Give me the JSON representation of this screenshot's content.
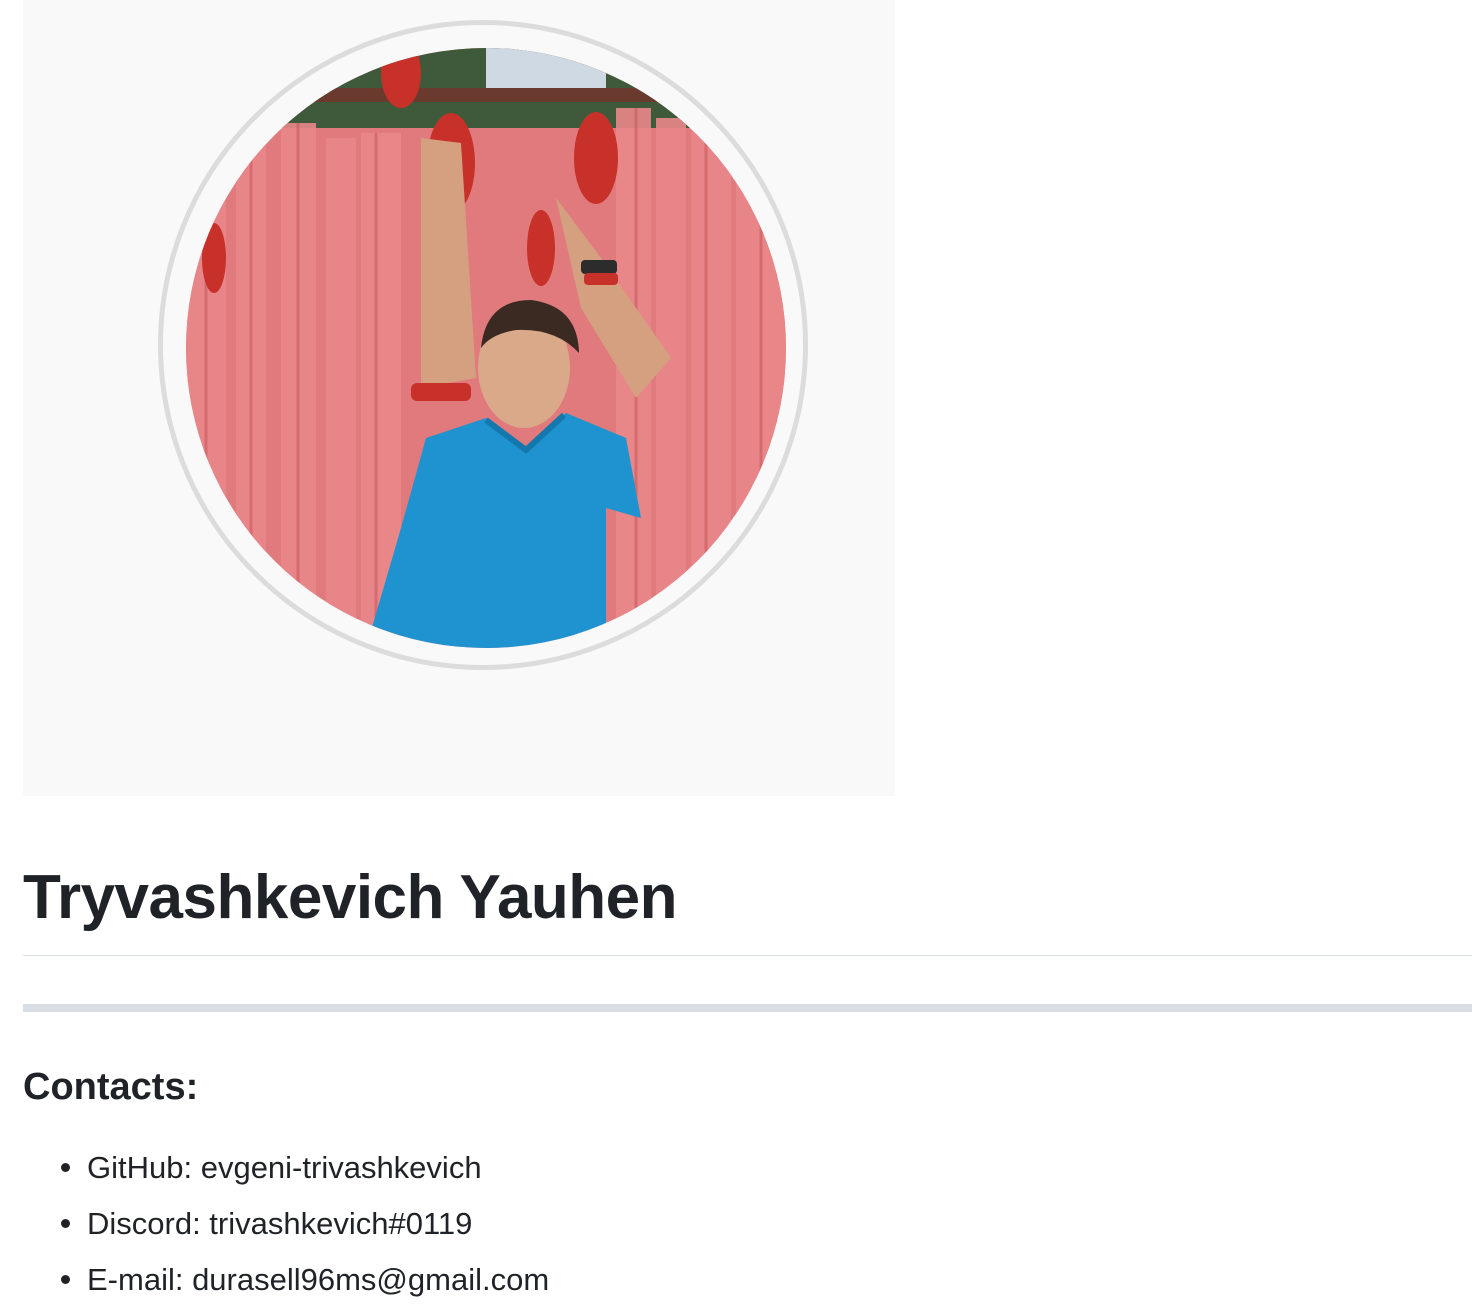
{
  "profile": {
    "name": "Tryvashkevich Yauhen",
    "avatar_alt": "avatar-photo"
  },
  "contacts": {
    "heading": "Contacts:",
    "items": [
      {
        "label": "GitHub: evgeni-trivashkevich"
      },
      {
        "label": "Discord: trivashkevich#0119"
      },
      {
        "label": "E-mail: durasell96ms@gmail.com"
      }
    ]
  },
  "colors": {
    "text": "#1f2328",
    "rule": "#d8dee4",
    "panel": "#f9f9f9"
  }
}
